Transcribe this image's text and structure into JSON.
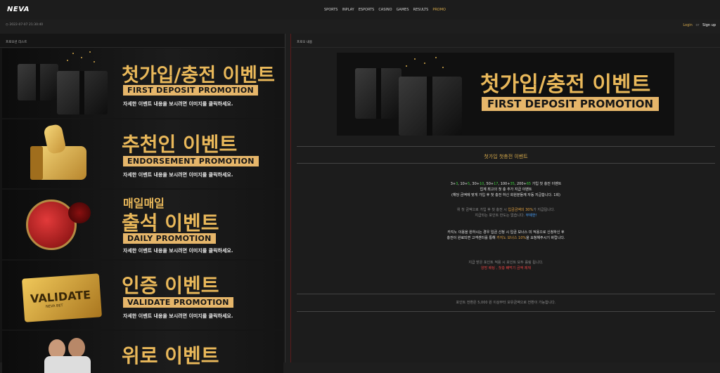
{
  "header": {
    "logo": "NEVA",
    "nav": [
      "SPORTS",
      "INPLAY",
      "ESPORTS",
      "CASINO",
      "GAMES",
      "RESULTS",
      "PROMO"
    ],
    "active_nav": "PROMO",
    "clock": "2022-07-07 21:30:40",
    "login": "Login",
    "or": "or",
    "signup": "Sign up"
  },
  "left_panel": {
    "title": "프로모션 리스트",
    "banners": [
      {
        "pre": "",
        "title": "첫가입/충전 이벤트",
        "sub": "FIRST DEPOSIT PROMOTION",
        "note": "자세한 이벤트 내용을 보시려면 이미지를 클릭하세요.",
        "icon": "gift-box-icon"
      },
      {
        "pre": "",
        "title": "추천인 이벤트",
        "sub": "ENDORSEMENT PROMOTION",
        "note": "자세한 이벤트 내용을 보시려면 이미지를 클릭하세요.",
        "icon": "thumbs-up-icon"
      },
      {
        "pre": "매일매일",
        "title": "출석 이벤트",
        "sub": "DAILY PROMOTION",
        "note": "자세한 이벤트 내용을 보시려면 이미지를 클릭하세요.",
        "icon": "stamp-icon"
      },
      {
        "pre": "",
        "title": "인증 이벤트",
        "sub": "VALIDATE PROMOTION",
        "note": "자세한 이벤트 내용을 보시려면 이미지를 클릭하세요.",
        "icon": "ticket-icon",
        "ticket_text": "VALIDATE",
        "ticket_small": "NEVA BET"
      },
      {
        "pre": "",
        "title": "위로 이벤트",
        "sub": "",
        "note": "",
        "icon": "people-icon"
      }
    ]
  },
  "right_panel": {
    "title": "프로모 내용",
    "banner_title": "첫가입/충전 이벤트",
    "banner_sub": "FIRST DEPOSIT PROMOTION",
    "detail_title": "첫가입 첫충전 이벤트",
    "rates": [
      {
        "base": "3",
        "bonus": "3"
      },
      {
        "base": "10",
        "bonus": "5"
      },
      {
        "base": "30",
        "bonus": "10"
      },
      {
        "base": "50",
        "bonus": "17"
      },
      {
        "base": "100",
        "bonus": "35"
      },
      {
        "base": "200",
        "bonus": "65"
      }
    ],
    "rates_suffix": "가입 첫 충전 이벤트",
    "p1_line2": "업계 최고의 첫 충 추가 지급 이벤트",
    "p1_line3": "(해당 금액에 맞게 가입 후 첫 충전 하신 회원분들께 자동 지급합니다. 1회)",
    "p2_line1_a": "위 첫 금액으로 가입 후 첫 충전 시 ",
    "p2_line1_b": "입금금액의 30%",
    "p2_line1_c": "가 지급됩니다.",
    "p2_line2_a": "지급되는 포인트 한도는 없습니다. ",
    "p2_line2_b": "무제한!",
    "p3_line1": "카지노 이용을 원하시는 경우 입금 신청 시 입금 보너스 미 적용으로 신청하신 후",
    "p3_line2_a": "충전이 완료되면 고객센터를 통해 ",
    "p3_line2_b": "카지노 보너스 10%",
    "p3_line2_c": "을 요청해주시기 바랍니다.",
    "p4_line1": "지급 받은 포인트 적용 시 포인트 모두 롤링 됩니다.",
    "p4_line2": "양방 배팅 , 첫충 빼먹기 금액 제재",
    "footer_note": "포인트 전환은 5,000 원 이상부터 보유금액으로 전환이 가능합니다.",
    "colors": {
      "green": "#3bd13b",
      "orange": "#e0a040",
      "blue": "#4aa3ff",
      "red": "#e04040",
      "gold": "#d4a84b"
    }
  }
}
